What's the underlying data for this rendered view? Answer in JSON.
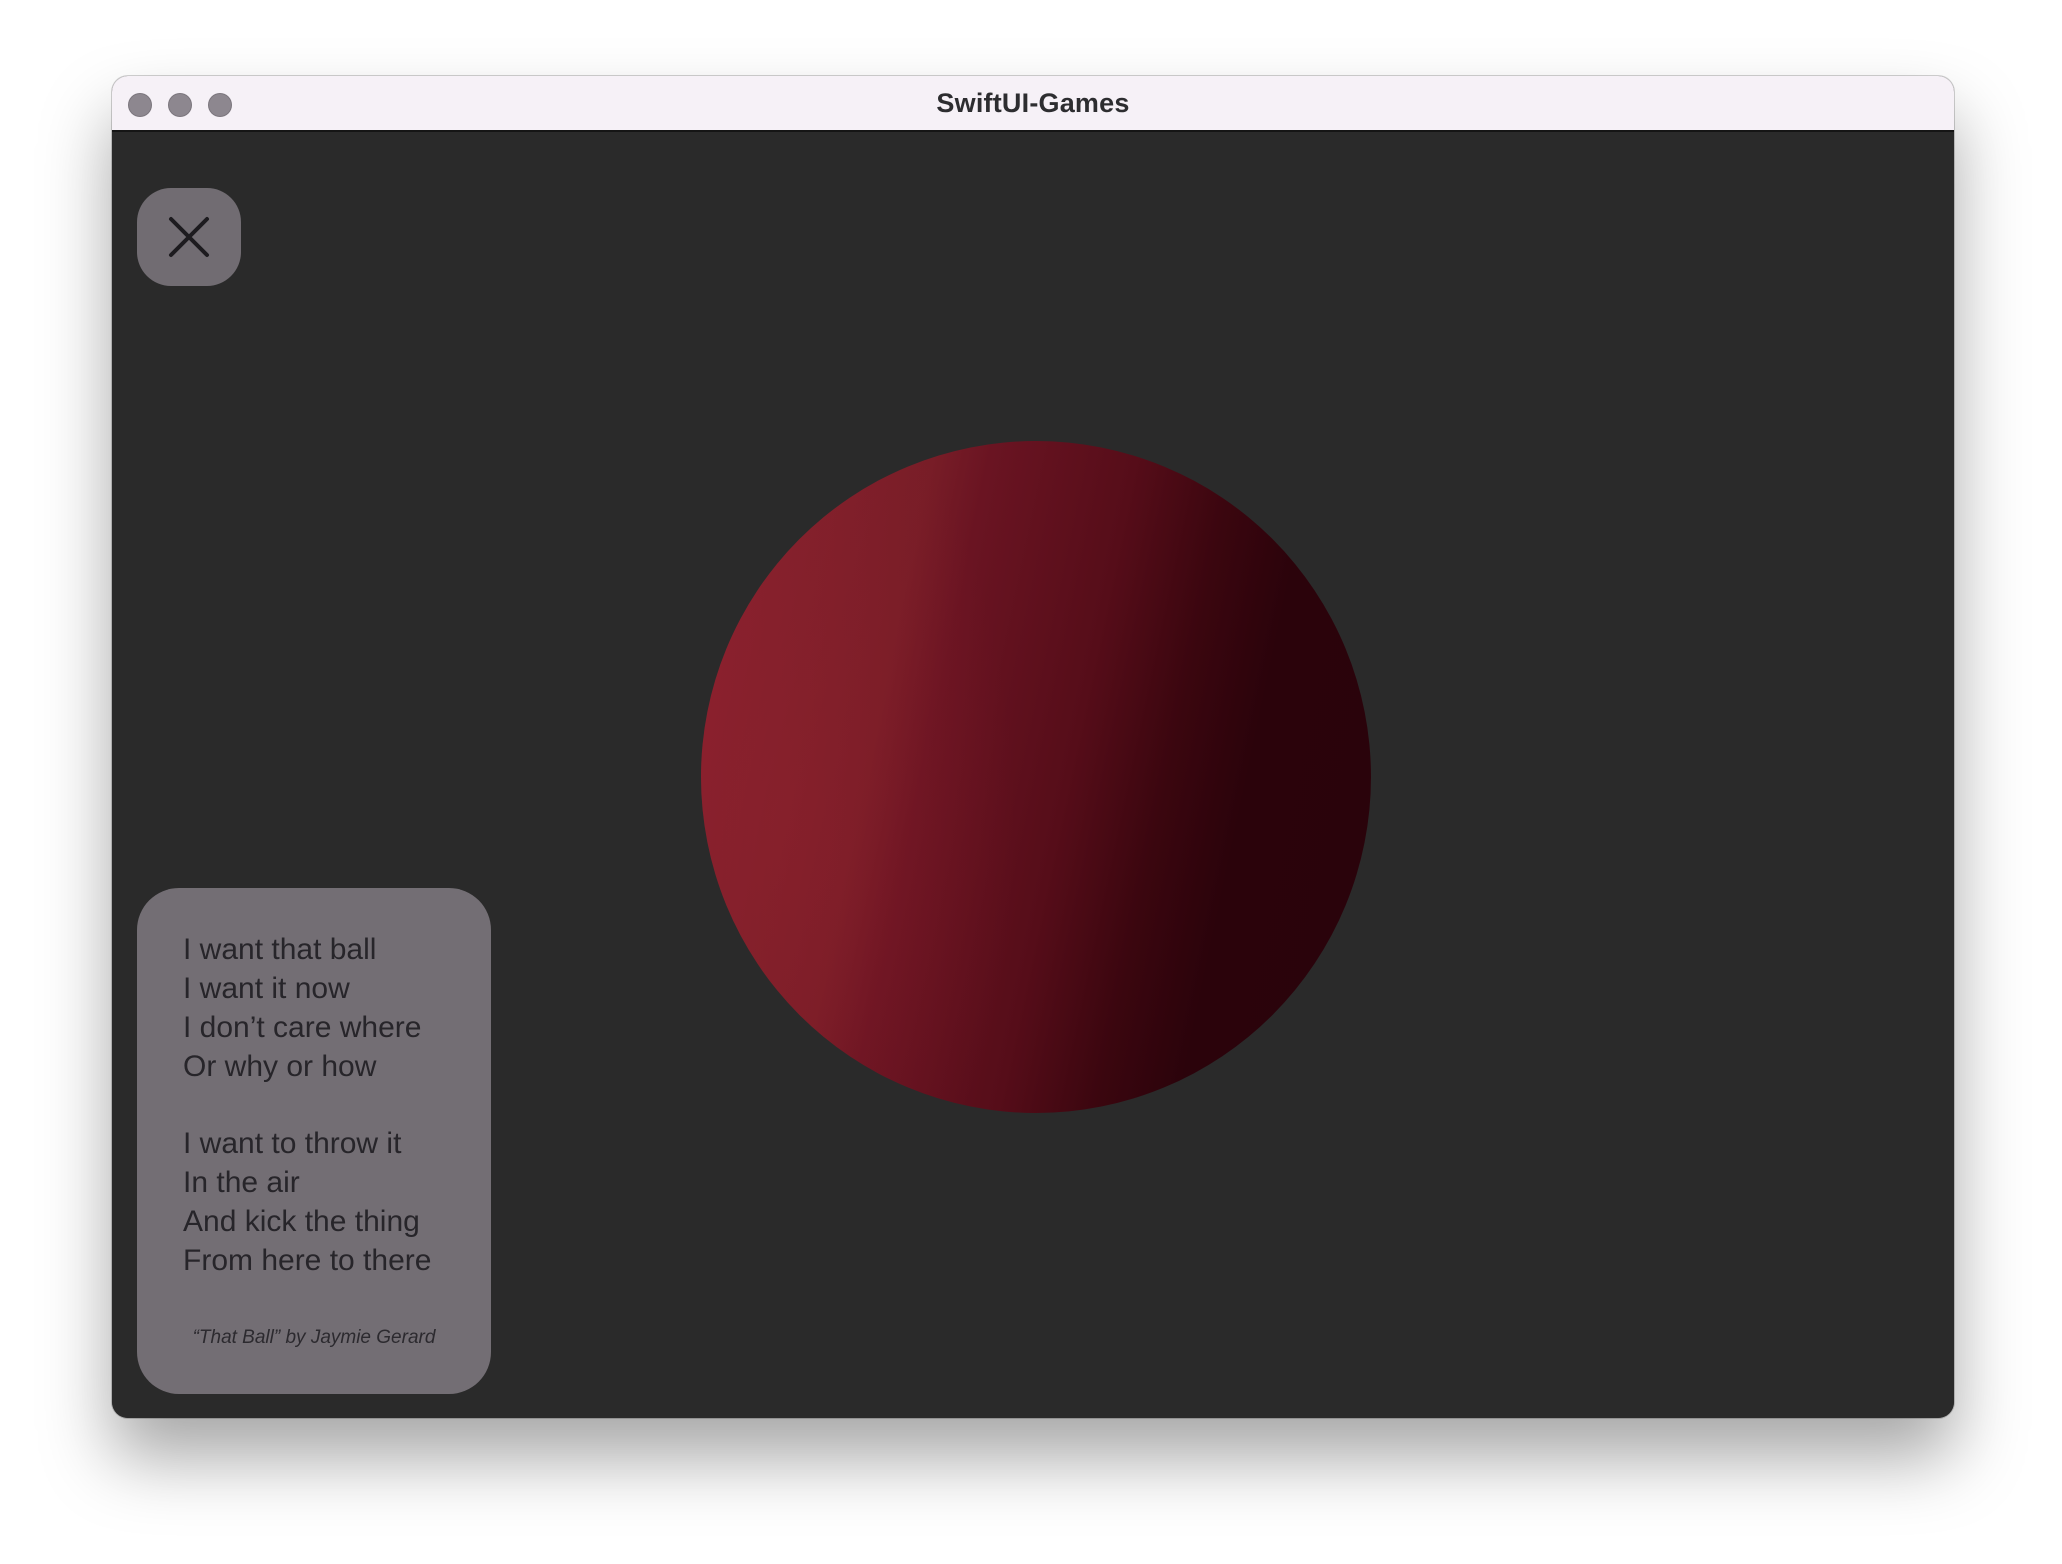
{
  "window": {
    "title": "SwiftUI-Games"
  },
  "controls": {
    "close_icon": "close-icon"
  },
  "ball": {
    "color": "#8f1f30",
    "shadow_color": "#2a030b"
  },
  "poem": {
    "stanza1": [
      "I want that ball",
      "I want it now",
      "I don’t care where",
      "Or why or how"
    ],
    "stanza2": [
      "I want to throw it",
      "In the air",
      "And kick the thing",
      "From here to there"
    ],
    "credit": "“That Ball” by Jaymie Gerard"
  },
  "colors": {
    "background": "#2a2a2a",
    "card": "#736e74",
    "titlebar": "#f6f1f7"
  }
}
